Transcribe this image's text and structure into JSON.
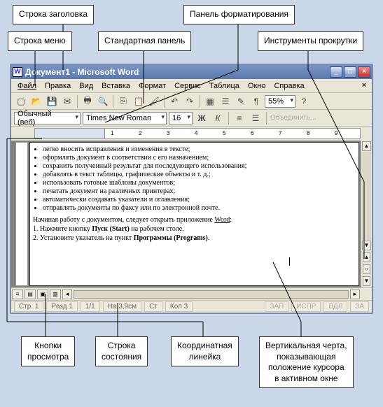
{
  "callouts": {
    "title_row": "Строка заголовка",
    "format_panel": "Панель форматирования",
    "menu_row": "Строка меню",
    "standard_panel": "Стандартная панель",
    "scroll_tools": "Инструменты прокрутки",
    "view_buttons": "Кнопки\nпросмотра",
    "status_row": "Строка\nсостояния",
    "coord_ruler": "Координатная\nлинейка",
    "cursor_line": "Вертикальная черта,\nпоказывающая\nположение курсора\nв активном окне"
  },
  "titlebar": {
    "icon": "W",
    "text": "Документ1 - Microsoft Word"
  },
  "menu": {
    "file": "Файл",
    "edit": "Правка",
    "view": "Вид",
    "insert": "Вставка",
    "format": "Формат",
    "tools": "Сервис",
    "table": "Таблица",
    "window": "Окно",
    "help": "Справка"
  },
  "toolbar": {
    "new": "new",
    "open": "open",
    "save": "save",
    "mail": "mail",
    "print": "print",
    "preview": "preview",
    "spell": "spell",
    "cut": "cut",
    "copy": "copy",
    "paste": "paste",
    "fmtpaint": "fmt",
    "undo": "undo",
    "redo": "redo",
    "table": "table",
    "cols": "cols",
    "draw": "draw",
    "map": "map",
    "zoom": "55%"
  },
  "format": {
    "style": "Обычный (веб)",
    "font": "Times New Roman",
    "size": "16",
    "bold": "Ж",
    "italic": "К",
    "align": "align",
    "list": "list",
    "merge": "Объединить..."
  },
  "doc": {
    "bullets": [
      "легко вносить исправления и изменения в тексте;",
      "оформлять документ в соответствии с его назначением;",
      "сохранить полученный результат для последующего использования;",
      "добавлять в текст таблицы, графические объекты и т. д.;",
      "использовать готовые шаблоны документов;",
      "печатать документ на различных принтерах;",
      "автоматически создавать указатели и оглавления;",
      "отправлять документы по факсу или по электронной почте."
    ],
    "para1a": "Начиная работу с документом, следует открыть приложение ",
    "para1b": "Word",
    "para1c": ":",
    "step1a": "1. Нажмите кнопку ",
    "step1b": "Пуск (Start)",
    "step1c": " на рабочем столе.",
    "step2a": "2. Установите указатель на пункт ",
    "step2b": "Программы (Programs)",
    "step2c": "."
  },
  "status": {
    "page": "Стр. 1",
    "section": "Разд 1",
    "pages": "1/1",
    "at": "На 3,9см",
    "ln": "Ст",
    "col": "Кол 3",
    "rec": "ЗАП",
    "trk": "ИСПР",
    "ext": "ВДЛ",
    "ovr": "ЗА"
  }
}
